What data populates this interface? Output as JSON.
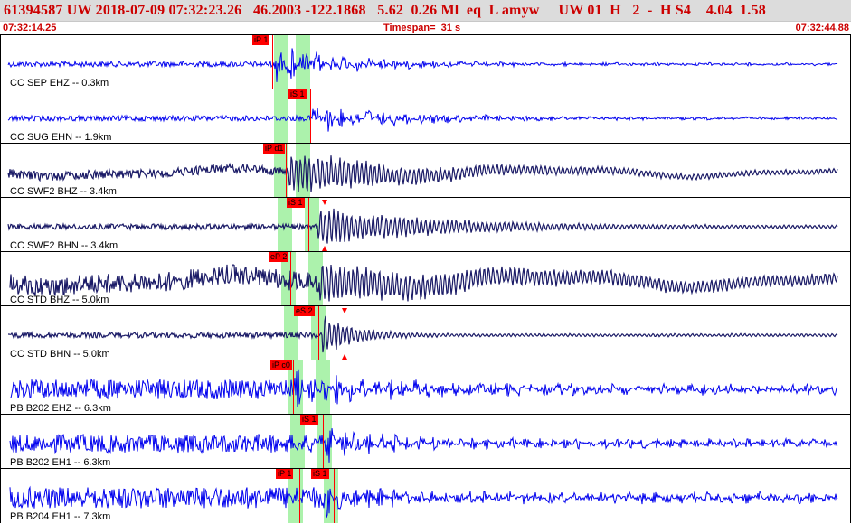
{
  "header": {
    "title": "61394587 UW 2018-07-09 07:32:23.26   46.2003 -122.1868   5.62  0.26 Ml  eq  L amyw     UW 01  H   2  -  H S4    4.04  1.58",
    "start_time": "07:32:14.25",
    "timespan": "Timespan=  31 s",
    "end_time": "07:32:44.88"
  },
  "colors": {
    "title_bg": "#dcdcdc",
    "title_text": "#cc0000",
    "trace_blue": "#0000ee",
    "trace_navy": "#1a1a66",
    "pick_tag": "#ff0000",
    "window": "#9ef09e"
  },
  "channels": [
    {
      "label": "CC SEP EHZ -- 0.3km",
      "color": "#0000ee",
      "picks": [
        "iP 1"
      ]
    },
    {
      "label": "CC SUG EHN -- 1.9km",
      "color": "#0000ee",
      "picks": [
        "iS 1"
      ]
    },
    {
      "label": "CC SWF2 BHZ -- 3.4km",
      "color": "#1a1a66",
      "picks": [
        "iP d1"
      ]
    },
    {
      "label": "CC SWF2 BHN -- 3.4km",
      "color": "#1a1a66",
      "picks": [
        "iS 1"
      ]
    },
    {
      "label": "CC STD BHZ -- 5.0km",
      "color": "#1a1a66",
      "picks": [
        "eP 2"
      ]
    },
    {
      "label": "CC STD BHN -- 5.0km",
      "color": "#1a1a66",
      "picks": [
        "eS 2"
      ]
    },
    {
      "label": "PB B202 EHZ -- 6.3km",
      "color": "#0000ee",
      "picks": [
        "iP c0"
      ]
    },
    {
      "label": "PB B202 EH1 -- 6.3km",
      "color": "#0000ee",
      "picks": [
        "iS 1"
      ]
    },
    {
      "label": "PB B204 EH1 -- 7.3km",
      "color": "#0000ee",
      "picks": [
        "iP 1",
        "iS 1"
      ]
    }
  ]
}
